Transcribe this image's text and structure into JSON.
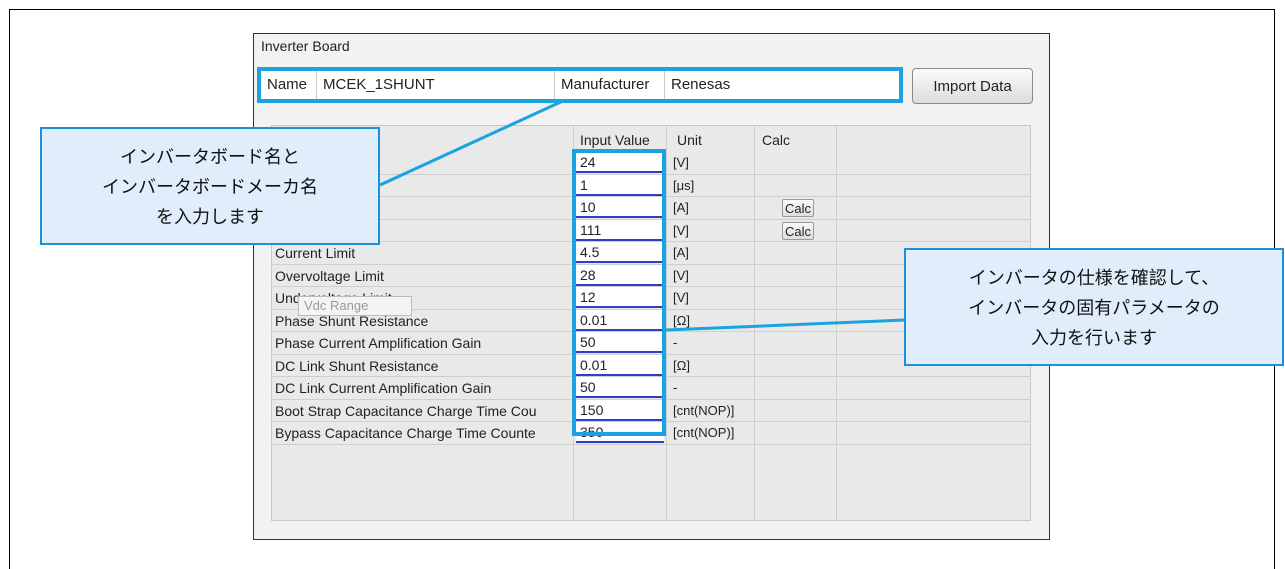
{
  "panel": {
    "title": "Inverter Board",
    "name_label": "Name",
    "name_value": "MCEK_1SHUNT",
    "manufacturer_label": "Manufacturer",
    "manufacturer_value": "Renesas",
    "import_button": "Import Data"
  },
  "table": {
    "headers": {
      "input_value": "Input Value",
      "unit": "Unit",
      "calc": "Calc"
    },
    "calc_label": "Calc",
    "rows": [
      {
        "name": "",
        "value": "24",
        "unit": "[V]"
      },
      {
        "name": "",
        "value": "1",
        "unit": "[μs]"
      },
      {
        "name": "",
        "value": "10",
        "unit": "[A]"
      },
      {
        "name": "Vdc Range",
        "value": "111",
        "unit": "[V]"
      },
      {
        "name": "Current Limit",
        "value": "4.5",
        "unit": "[A]"
      },
      {
        "name": "Overvoltage Limit",
        "value": "28",
        "unit": "[V]"
      },
      {
        "name": "Undervoltage Limit",
        "value": "12",
        "unit": "[V]"
      },
      {
        "name": "Phase Shunt Resistance",
        "value": "0.01",
        "unit": "[Ω]"
      },
      {
        "name": "Phase Current Amplification Gain",
        "value": "50",
        "unit": "-"
      },
      {
        "name": "DC Link Shunt Resistance",
        "value": "0.01",
        "unit": "[Ω]"
      },
      {
        "name": "DC Link Current Amplification Gain",
        "value": "50",
        "unit": "-"
      },
      {
        "name": "Boot Strap Capacitance Charge Time Cou",
        "value": "150",
        "unit": "[cnt(NOP)]"
      },
      {
        "name": "Bypass Capacitance Charge Time Counte",
        "value": "350",
        "unit": "[cnt(NOP)]"
      }
    ],
    "tooltip": "Vdc Range"
  },
  "callouts": {
    "left": [
      "インバータボード名と",
      "インバータボードメーカ名",
      "を入力します"
    ],
    "right": [
      "インバータの仕様を確認して、",
      "インバータの固有パラメータの",
      "入力を行います"
    ]
  },
  "colors": {
    "highlight": "#1aa3e0",
    "callout_bg": "#dfeefa",
    "input_underline": "#2b3fc7"
  }
}
